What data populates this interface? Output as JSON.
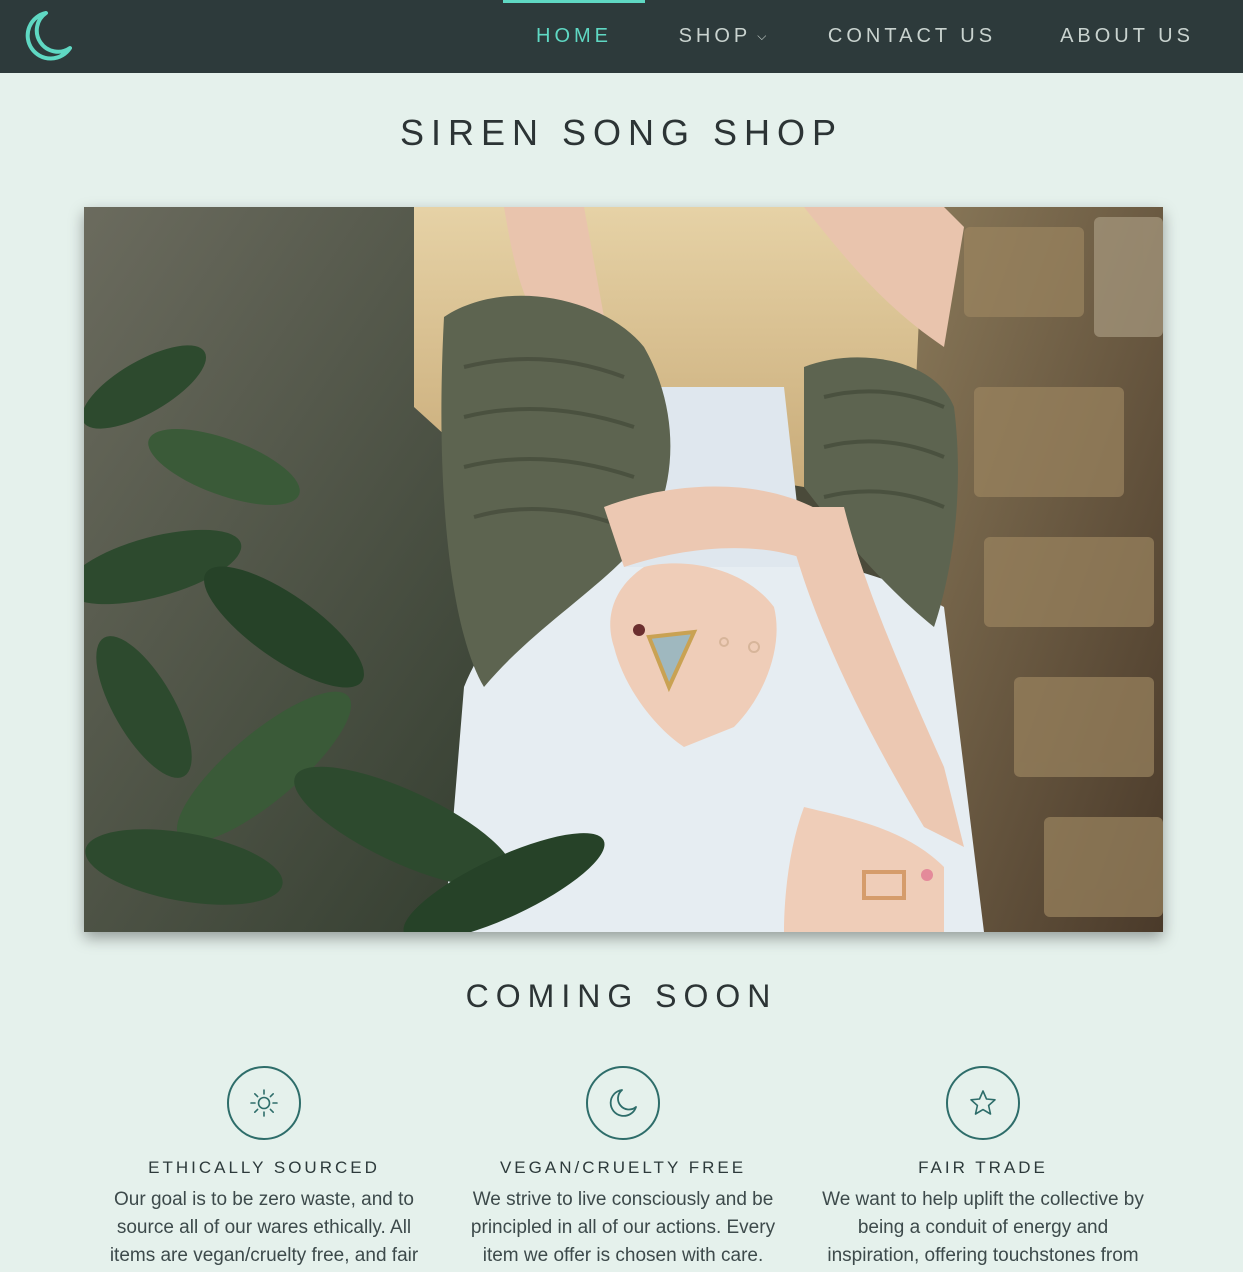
{
  "nav": {
    "logo_icon": "crescent-moon-icon",
    "items": [
      {
        "label": "HOME",
        "active": true
      },
      {
        "label": "SHOP",
        "has_dropdown": true
      },
      {
        "label": "CONTACT US"
      },
      {
        "label": "ABOUT US"
      }
    ],
    "accent_color": "#5fd8c3",
    "background_color": "#2d3a3b"
  },
  "page": {
    "title": "SIREN SONG SHOP",
    "hero_image": "woman-with-rings-photo",
    "subtitle": "COMING SOON",
    "background_color": "#e5f1ec"
  },
  "features": [
    {
      "icon": "sun-icon",
      "title": "ETHICALLY SOURCED",
      "text": "Our goal is to be zero waste, and to source all of our wares ethically. All items are vegan/cruelty free, and fair"
    },
    {
      "icon": "moon-icon",
      "title": "VEGAN/CRUELTY FREE",
      "text": "We strive to live consciously and be principled in all of our actions. Every item we offer is chosen with care."
    },
    {
      "icon": "star-icon",
      "title": "FAIR TRADE",
      "text": "We want to help uplift the collective by being a conduit of energy and inspiration, offering touchstones from"
    }
  ]
}
